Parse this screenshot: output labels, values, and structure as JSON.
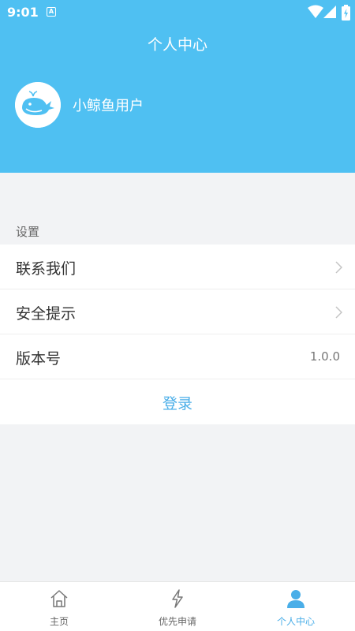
{
  "status": {
    "time": "9:01",
    "indicator": "A",
    "icons": [
      "wifi-icon",
      "signal-icon",
      "battery-icon"
    ]
  },
  "header": {
    "title": "个人中心",
    "username": "小鲸鱼用户",
    "avatar_icon": "whale-icon",
    "color": "#4fc0f2"
  },
  "settings": {
    "label": "设置",
    "items": [
      {
        "label": "联系我们",
        "icon": "chevron-right-icon"
      },
      {
        "label": "安全提示",
        "icon": "chevron-right-icon"
      },
      {
        "label": "版本号",
        "value": "1.0.0"
      }
    ],
    "login_label": "登录"
  },
  "tabbar": {
    "tabs": [
      {
        "label": "主页",
        "icon": "home-icon",
        "active": false
      },
      {
        "label": "优先申请",
        "icon": "lightning-icon",
        "active": false
      },
      {
        "label": "个人中心",
        "icon": "person-icon",
        "active": true
      }
    ],
    "active_color": "#4aaee8"
  }
}
